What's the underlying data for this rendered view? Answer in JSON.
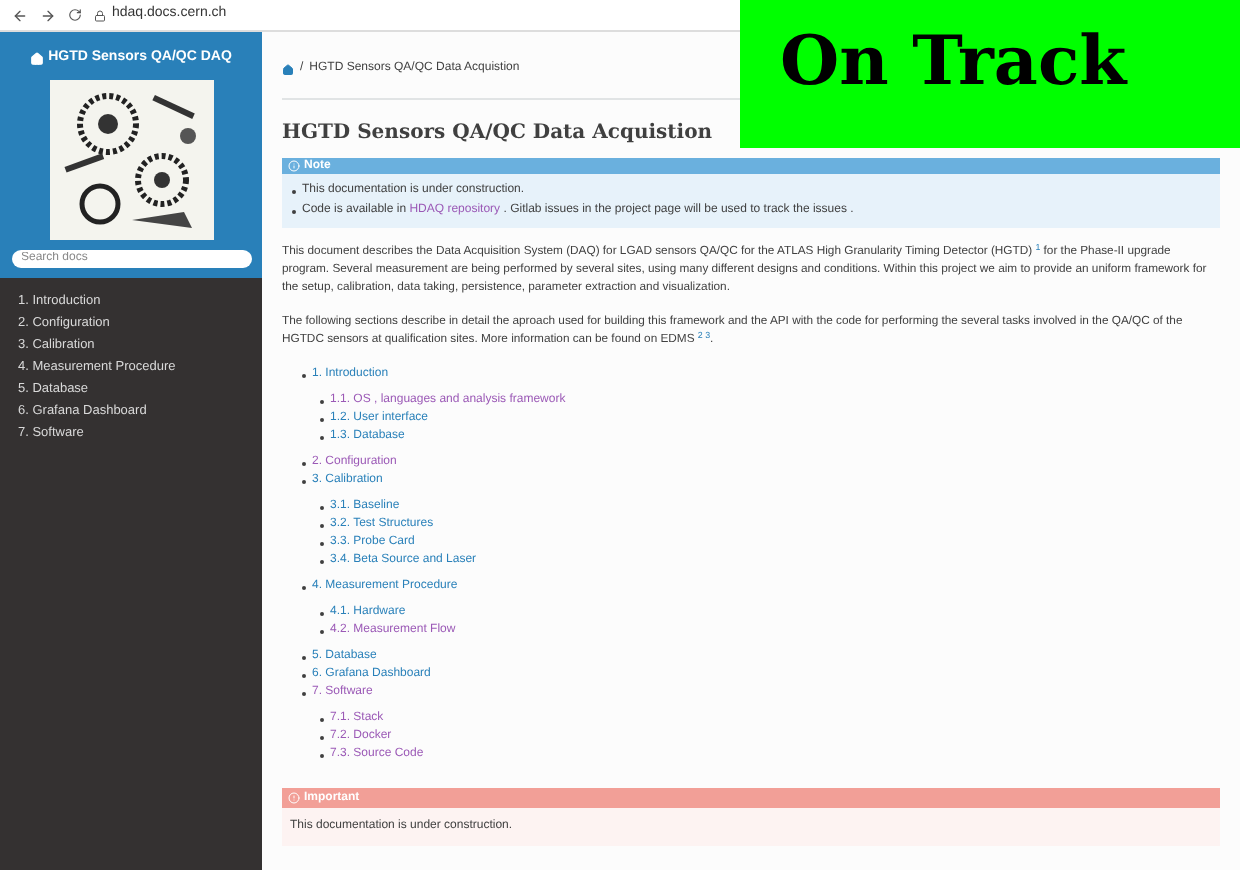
{
  "browser": {
    "url": "hdaq.docs.cern.ch"
  },
  "sidebar": {
    "title": "HGTD Sensors QA/QC DAQ",
    "search": {
      "placeholder": "Search docs"
    },
    "items": [
      {
        "label": "1. Introduction"
      },
      {
        "label": "2. Configuration"
      },
      {
        "label": "3. Calibration"
      },
      {
        "label": "4. Measurement Procedure"
      },
      {
        "label": "5. Database"
      },
      {
        "label": "6. Grafana Dashboard"
      },
      {
        "label": "7. Software"
      }
    ]
  },
  "breadcrumb": {
    "separator": "/",
    "text": "HGTD Sensors QA/QC Data Acquistion"
  },
  "overlay": {
    "text": "On Track"
  },
  "title": "HGTD Sensors QA/QC Data Acquistion",
  "note": {
    "header": "Note",
    "items": [
      {
        "parts": [
          {
            "kind": "text",
            "text": "This documentation is under construction."
          }
        ]
      },
      {
        "parts": [
          {
            "kind": "text",
            "text": "Code is available in "
          },
          {
            "kind": "link",
            "text": "HDAQ repository"
          },
          {
            "kind": "text",
            "text": " . Gitlab issues in the project page will be used to track the issues ."
          }
        ]
      }
    ]
  },
  "paragraphs": [
    "This document describes the Data Acquisition System (DAQ) for LGAD sensors QA/QC for the ATLAS High Granularity Timing Detector (HGTD) $^{1}$ for the Phase-II upgrade program. Several measurement are being performed by several sites, using many different designs and conditions. Within this project we aim to provide an uniform framework for the setup, calibration, data taking, persistence, parameter extraction and visualization.",
    "The following sections describe in detail the aproach used for building this framework and the API with the code for performing the several tasks involved in the QA/QC of the HGTDC sensors at qualification sites. More information can be found on EDMS $^{2 3}$."
  ],
  "toc": [
    {
      "label": "1. Introduction",
      "visited": false,
      "children": [
        {
          "label": "1.1. OS , languages and analysis framework",
          "visited": true
        },
        {
          "label": "1.2. User interface",
          "visited": false
        },
        {
          "label": "1.3. Database",
          "visited": false
        }
      ]
    },
    {
      "label": "2. Configuration",
      "visited": true
    },
    {
      "label": "3. Calibration",
      "visited": false,
      "children": [
        {
          "label": "3.1. Baseline",
          "visited": false
        },
        {
          "label": "3.2. Test Structures",
          "visited": false
        },
        {
          "label": "3.3. Probe Card",
          "visited": false
        },
        {
          "label": "3.4. Beta Source and Laser",
          "visited": false
        }
      ]
    },
    {
      "label": "4. Measurement Procedure",
      "visited": false,
      "children": [
        {
          "label": "4.1. Hardware",
          "visited": false
        },
        {
          "label": "4.2. Measurement Flow",
          "visited": true
        }
      ]
    },
    {
      "label": "5. Database",
      "visited": false
    },
    {
      "label": "6. Grafana Dashboard",
      "visited": false
    },
    {
      "label": "7. Software",
      "visited": true,
      "children": [
        {
          "label": "7.1. Stack",
          "visited": true
        },
        {
          "label": "7.2. Docker",
          "visited": true
        },
        {
          "label": "7.3. Source Code",
          "visited": true
        }
      ]
    }
  ],
  "important": {
    "header": "Important",
    "text": "This documentation is under construction."
  }
}
